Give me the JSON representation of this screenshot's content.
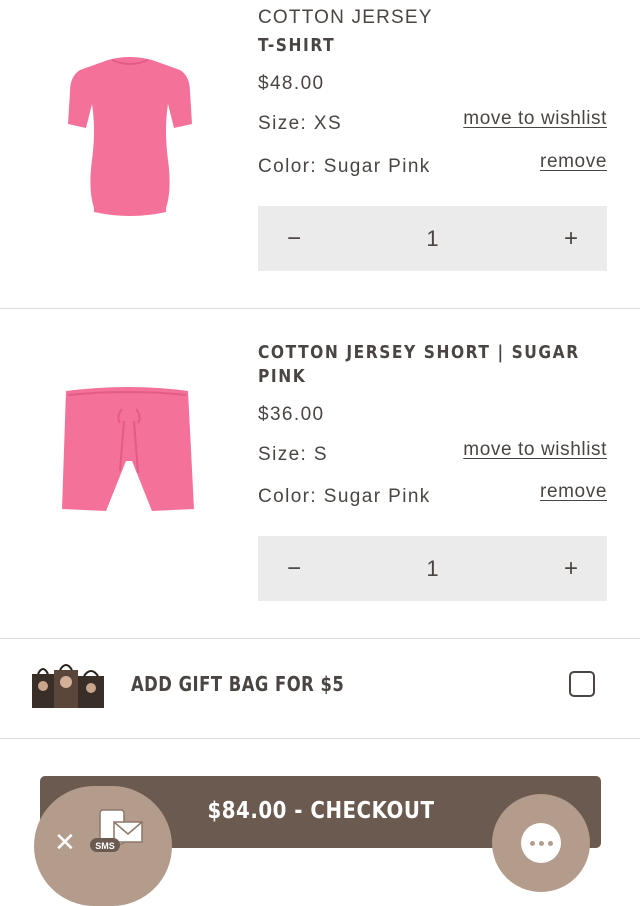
{
  "cart": {
    "items": [
      {
        "name_line1": "COTTON JERSEY",
        "name_line2": "T-SHIRT",
        "price": "$48.00",
        "size": "Size: XS",
        "color": "Color: Sugar Pink",
        "wishlist_label": "move to wishlist",
        "remove_label": "remove",
        "quantity": "1",
        "image_icon": "pink-tshirt-image"
      },
      {
        "name_line1": "COTTON JERSEY SHORT | SUGAR",
        "name_line2": "PINK",
        "price": "$36.00",
        "size": "Size: S",
        "color": "Color: Sugar Pink",
        "wishlist_label": "move to wishlist",
        "remove_label": "remove",
        "quantity": "1",
        "image_icon": "pink-shorts-image"
      }
    ],
    "qty_minus": "−",
    "qty_plus": "+"
  },
  "gift": {
    "label": "ADD GIFT BAG FOR $5",
    "checked": false
  },
  "checkout": {
    "label": "$84.00 - CHECKOUT"
  },
  "widgets": {
    "sms_close": "✕",
    "sms_badge": "SMS"
  },
  "colors": {
    "text": "#4a4542",
    "checkout_bg": "#6a5a4f",
    "product_pink": "#f4719a",
    "qty_bg": "#ebebeb",
    "widget_bg": "#b39c8c"
  }
}
